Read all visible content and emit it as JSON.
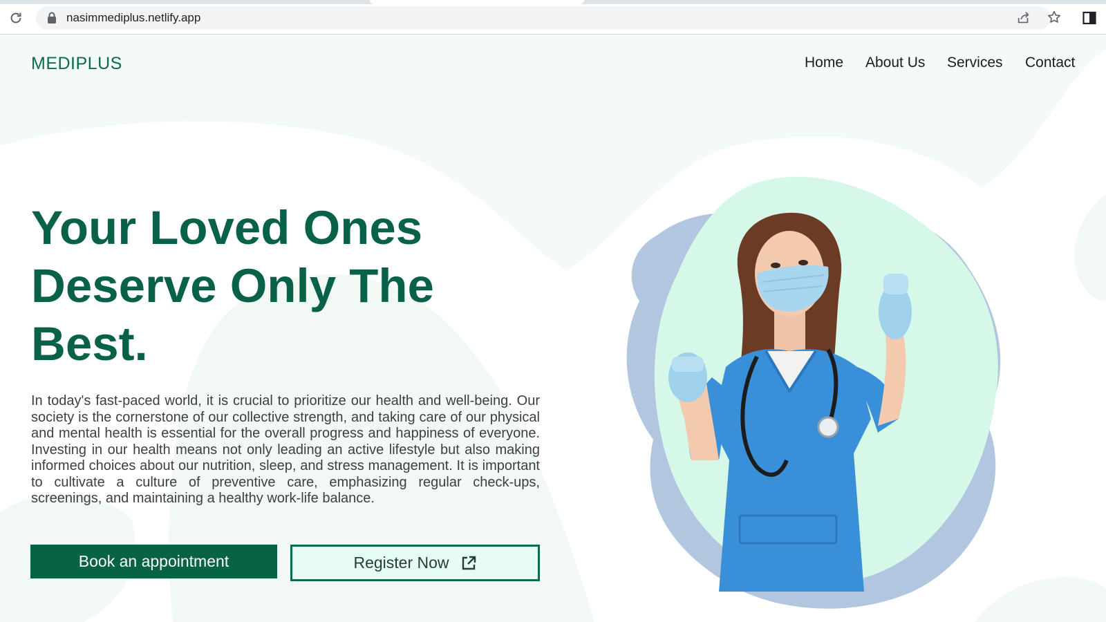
{
  "browser": {
    "url": "nasimmediplus.netlify.app"
  },
  "header": {
    "logo": "MEDIPLUS",
    "nav": [
      "Home",
      "About Us",
      "Services",
      "Contact"
    ]
  },
  "hero": {
    "headline_lines": [
      "Your Loved Ones",
      "Deserve Only The",
      "Best."
    ],
    "body": "In today's fast-paced world, it is crucial to prioritize our health and well-being. Our society is the cornerstone of our collective strength, and taking care of our physical and mental health is essential for the overall progress and happiness of everyone. Investing in our health means not only leading an active lifestyle but also making informed choices about our nutrition, sleep, and stress management. It is important to cultivate a culture of preventive care, emphasizing regular check-ups, screenings, and maintaining a healthy work-life balance.",
    "primary_button": "Book an appointment",
    "secondary_button": "Register Now"
  },
  "colors": {
    "brand": "#0b6b4b",
    "button_fill": "#076246",
    "button_outline_bg": "#e6fbf2",
    "blob_mint": "#d6f8e8",
    "blob_blue": "#b2c7df",
    "scrubs": "#3a8fd9"
  },
  "icons": [
    "reload-icon",
    "lock-icon",
    "share-icon",
    "star-icon",
    "side-panel-icon",
    "external-link-icon"
  ]
}
